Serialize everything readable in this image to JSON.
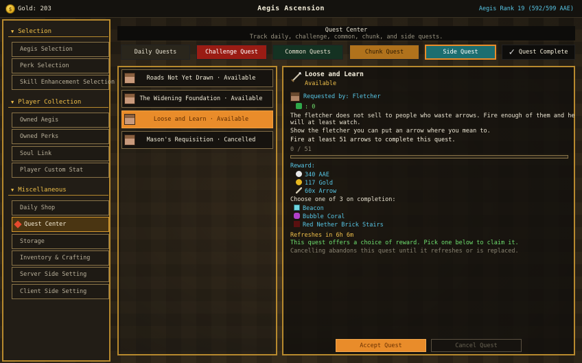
{
  "topbar": {
    "gold": "Gold: 203",
    "title": "Aegis Ascension",
    "rank": "Aegis Rank 19 (592/599 AAE)"
  },
  "sidebar": {
    "sections": [
      {
        "heading": "Selection",
        "items": [
          "Aegis Selection",
          "Perk Selection",
          "Skill Enhancement Selection"
        ]
      },
      {
        "heading": "Player Collection",
        "items": [
          "Owned Aegis",
          "Owned Perks",
          "Soul Link",
          "Player Custom Stat"
        ]
      },
      {
        "heading": "Miscellaneous",
        "items": [
          "Daily Shop",
          "Quest Center",
          "Storage",
          "Inventory & Crafting",
          "Server Side Setting",
          "Client Side Setting"
        ]
      }
    ],
    "active_item": "Quest Center"
  },
  "header": {
    "title": "Quest Center",
    "subtitle": "Track daily, challenge, common, chunk, and side quests."
  },
  "tabs": [
    {
      "label": "Daily Quests",
      "bg": "#2a261c",
      "fg": "#e8e2d0"
    },
    {
      "label": "Challenge Quest",
      "bg": "#9a1c14",
      "fg": "#ffffff"
    },
    {
      "label": "Common Quests",
      "bg": "#143222",
      "fg": "#e8e2d0"
    },
    {
      "label": "Chunk Quest",
      "bg": "#b0721c",
      "fg": "#2a1800"
    },
    {
      "label": "Side Quest",
      "bg": "#1c6e70",
      "fg": "#ffffff"
    },
    {
      "label": "Quest Complete",
      "bg": "#0e0d0b",
      "fg": "#f2ecd8"
    }
  ],
  "quests": [
    {
      "text": "Roads Not Yet Drawn  ·  Available"
    },
    {
      "text": "The Widening Foundation  ·  Available"
    },
    {
      "text": "Loose and Learn  ·  Available"
    },
    {
      "text": "Mason's Requisition  ·  Cancelled"
    }
  ],
  "detail": {
    "name": "Loose and Learn",
    "status": "Available",
    "requested_by": "Requested by: Fletcher",
    "emeralds": ": 0",
    "desc_line1": "The fletcher does not sell to people who waste arrows. Fire enough of them and he",
    "desc_line2": "will at least watch.",
    "desc_line3": "Show the fletcher you can put an arrow where you mean to.",
    "objective": "Fire at least 51 arrows to complete this quest.",
    "progress_text": "0 / 51",
    "progress": 0,
    "reward_label": "Reward:",
    "rewards": [
      "340 AAE",
      "117 Gold",
      "60x Arrow"
    ],
    "choose_label": "Choose one of 3 on completion:",
    "choices": [
      "Beacon",
      "Bubble Coral",
      "Red Nether Brick Stairs"
    ],
    "refresh": "Refreshes in 6h 6m",
    "offer_note": "This quest offers a choice of reward. Pick one below to claim it.",
    "cancel_note": "Cancelling abandons this quest until it refreshes or is replaced.",
    "accept_button": "Accept Quest",
    "cancel_button": "Cancel Quest"
  },
  "icons": {
    "gold": "gold-coin-icon",
    "arrow": "arrow-icon",
    "villager": "villager-face-icon",
    "emerald": "emerald-icon",
    "aae": "aae-orb-icon",
    "check": "checkmark-icon",
    "beacon": "beacon-icon",
    "coral": "bubble-coral-icon",
    "stairs": "nether-brick-stairs-icon"
  },
  "colors": {
    "accent_gold": "#b88a2e",
    "active_orange": "#e98c2a",
    "cyan": "#57c6e6",
    "green": "#6fe06f",
    "yellow": "#f0c04a"
  }
}
